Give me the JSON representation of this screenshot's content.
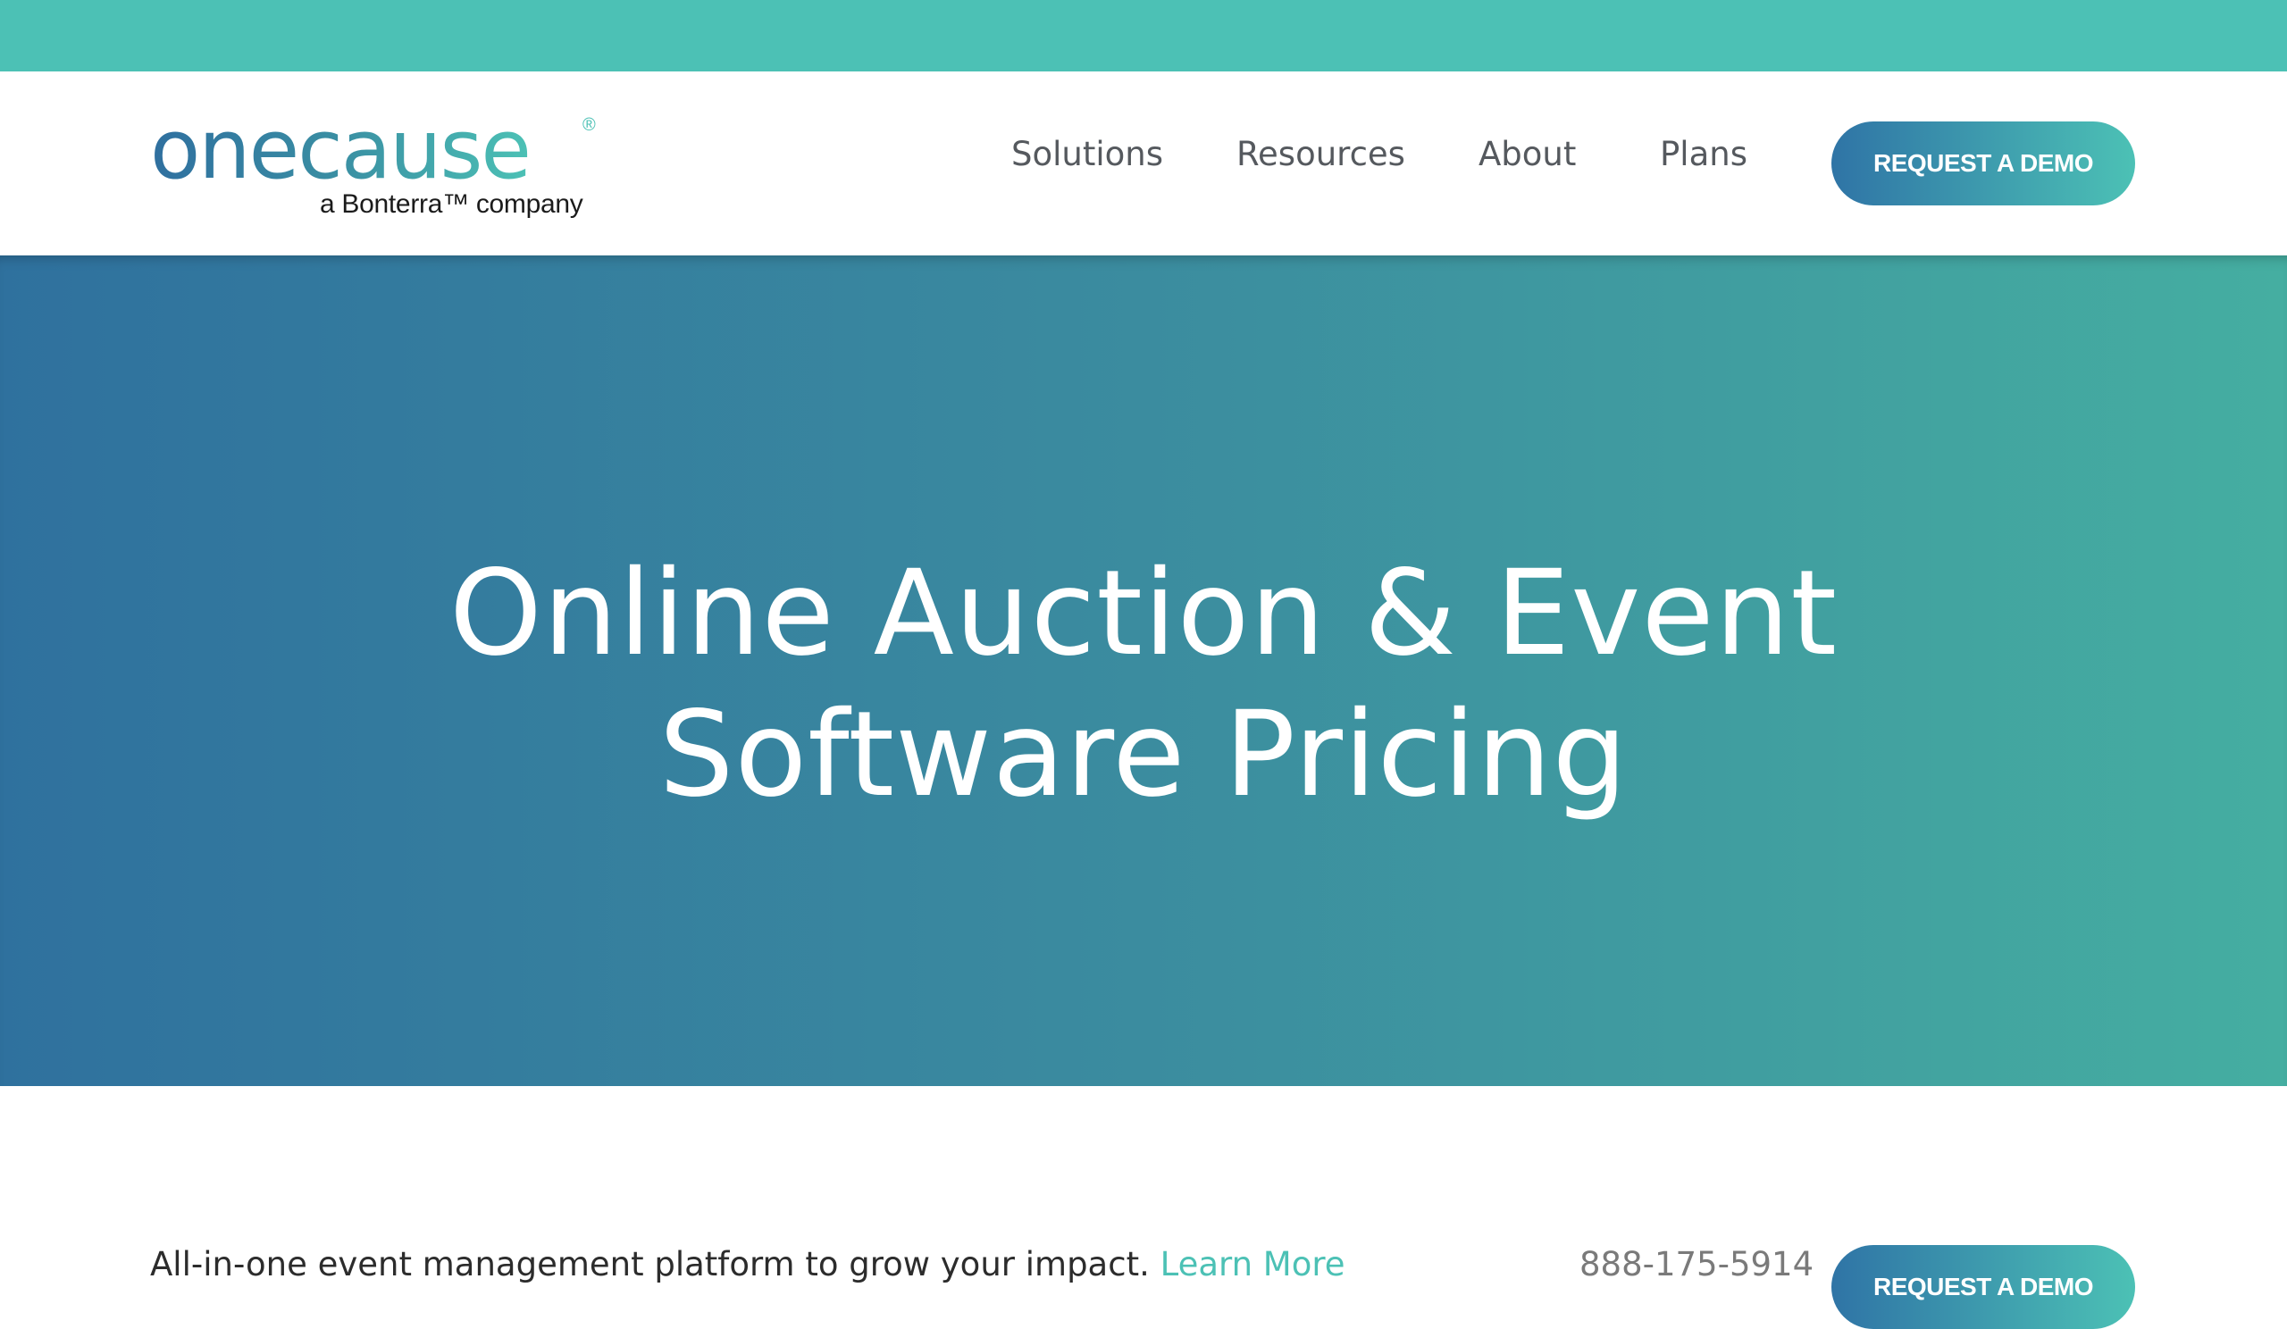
{
  "brand": {
    "logo_word": "onecause",
    "logo_registered": "®",
    "logo_tagline": "a Bonterra™ company",
    "colors": {
      "teal": "#4cc1b5",
      "blue": "#2f719e",
      "nav_text": "#55595e"
    }
  },
  "nav": {
    "items": [
      {
        "label": "Solutions"
      },
      {
        "label": "Resources"
      },
      {
        "label": "About"
      },
      {
        "label": "Plans"
      }
    ],
    "cta_label": "REQUEST A DEMO"
  },
  "hero": {
    "title_line1": "Online Auction & Event",
    "title_line2": "Software Pricing"
  },
  "subbar": {
    "tagline": "All-in-one event management platform to grow your impact.",
    "learn_more": "Learn More",
    "phone": "888-175-5914",
    "cta_label": "REQUEST A DEMO"
  }
}
